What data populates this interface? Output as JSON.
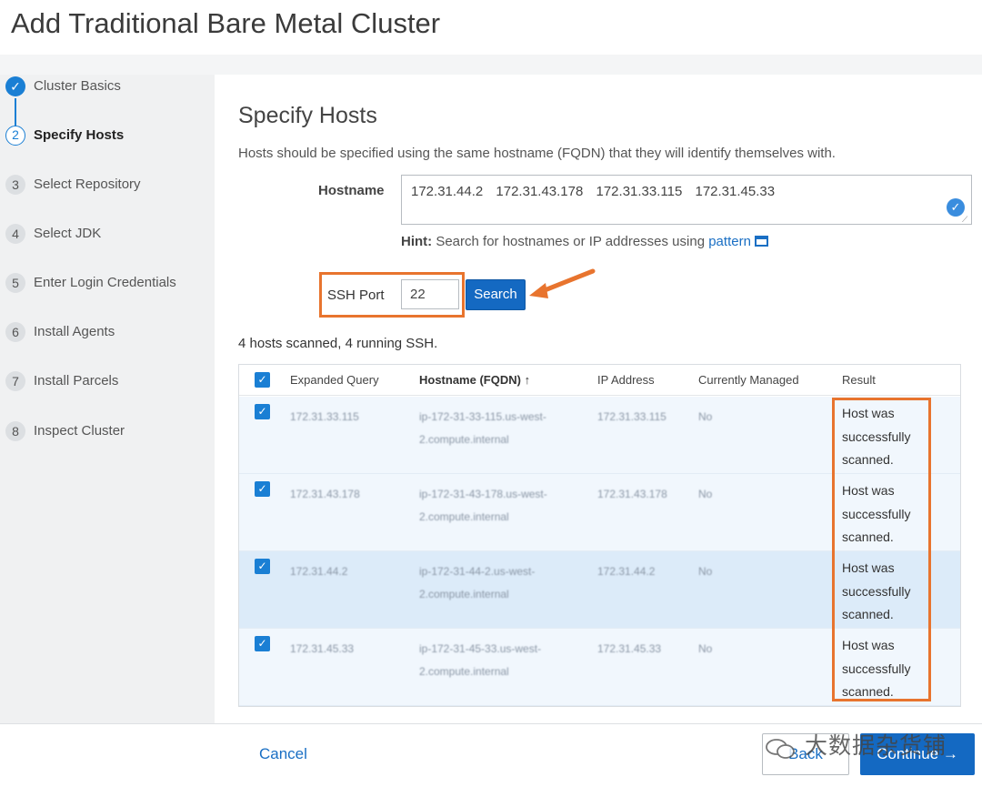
{
  "page": {
    "title": "Add Traditional Bare Metal Cluster"
  },
  "sidebar": {
    "steps": [
      {
        "num": "✓",
        "label": "Cluster Basics"
      },
      {
        "num": "2",
        "label": "Specify Hosts"
      },
      {
        "num": "3",
        "label": "Select Repository"
      },
      {
        "num": "4",
        "label": "Select JDK"
      },
      {
        "num": "5",
        "label": "Enter Login Credentials"
      },
      {
        "num": "6",
        "label": "Install Agents"
      },
      {
        "num": "7",
        "label": "Install Parcels"
      },
      {
        "num": "8",
        "label": "Inspect Cluster"
      }
    ]
  },
  "main": {
    "title": "Specify Hosts",
    "instructions": "Hosts should be specified using the same hostname (FQDN) that they will identify themselves with.",
    "hostname_label": "Hostname",
    "hostname_value": "172.31.44.2 172.31.43.178 172.31.33.115 172.31.45.33",
    "hint_prefix": "Hint:",
    "hint_text": "Search for hostnames or IP addresses using",
    "hint_link": "pattern",
    "ssh_port_label": "SSH Port",
    "ssh_port_value": "22",
    "search_button": "Search",
    "scan_summary": "4 hosts scanned, 4 running SSH."
  },
  "table": {
    "headers": {
      "expanded_query": "Expanded Query",
      "hostname": "Hostname (FQDN)",
      "sort_indicator": "↑",
      "ip": "IP Address",
      "managed": "Currently Managed",
      "result": "Result"
    },
    "rows": [
      {
        "query": "172.31.33.115",
        "fqdn": "ip-172-31-33-115.us-west-2.compute.internal",
        "ip": "172.31.33.115",
        "managed": "No",
        "result": "Host was successfully scanned."
      },
      {
        "query": "172.31.43.178",
        "fqdn": "ip-172-31-43-178.us-west-2.compute.internal",
        "ip": "172.31.43.178",
        "managed": "No",
        "result": "Host was successfully scanned."
      },
      {
        "query": "172.31.44.2",
        "fqdn": "ip-172-31-44-2.us-west-2.compute.internal",
        "ip": "172.31.44.2",
        "managed": "No",
        "result": "Host was successfully scanned."
      },
      {
        "query": "172.31.45.33",
        "fqdn": "ip-172-31-45-33.us-west-2.compute.internal",
        "ip": "172.31.45.33",
        "managed": "No",
        "result": "Host was successfully scanned."
      }
    ]
  },
  "footer": {
    "cancel": "Cancel",
    "back": "Back",
    "continue": "Continue →"
  },
  "watermark": {
    "text": "大数据杂货铺"
  },
  "colors": {
    "accent": "#1469c2",
    "highlight": "#e8742e",
    "sidebar_bg": "#f0f1f2"
  }
}
